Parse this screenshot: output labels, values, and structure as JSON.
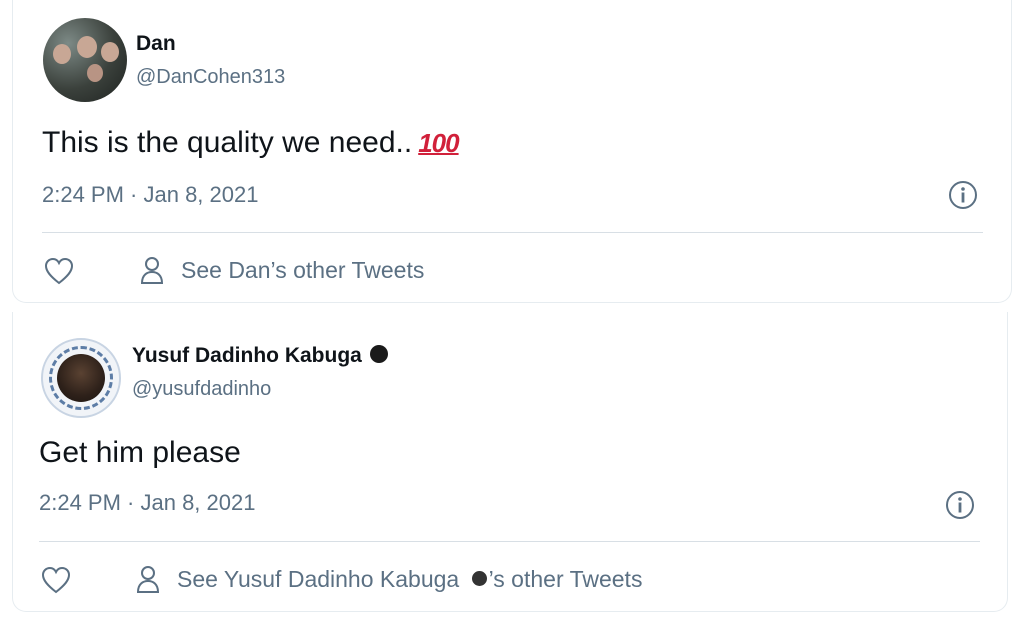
{
  "tweets": [
    {
      "name": "Dan",
      "handle": "@DanCohen313",
      "text": "This is the quality we need..",
      "emoji": "💯",
      "emoji_text": "100",
      "timestamp": "2:24 PM · Jan 8, 2021",
      "other_tweets_label": "See Dan’s other Tweets",
      "accent": "#d1203a"
    },
    {
      "name": "Yusuf Dadinho Kabuga",
      "verified": true,
      "handle": "@yusufdadinho",
      "text": "Get him please",
      "timestamp": "2:24 PM · Jan 8, 2021",
      "other_tweets_prefix": "See Yusuf Dadinho Kabuga ",
      "other_tweets_suffix": "’s other Tweets"
    }
  ],
  "icons": {
    "like": "heart-icon",
    "profile": "person-icon",
    "info": "info-icon",
    "verified": "verified-badge-icon"
  },
  "colors": {
    "text_primary": "#0f1419",
    "text_secondary": "#5b7083",
    "divider": "#d8dfe5",
    "card_border": "#e6ecf0"
  }
}
